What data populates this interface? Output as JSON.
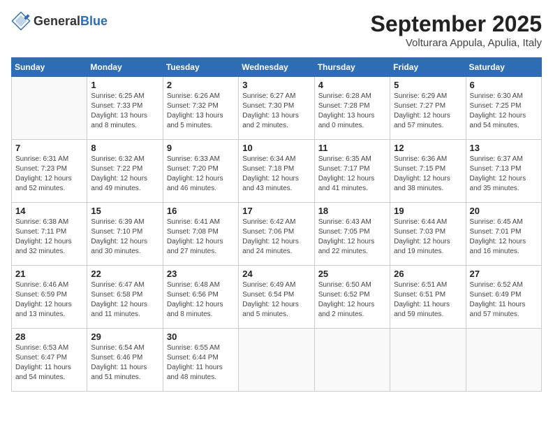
{
  "header": {
    "logo": {
      "general": "General",
      "blue": "Blue"
    },
    "title": "September 2025",
    "location": "Volturara Appula, Apulia, Italy"
  },
  "weekdays": [
    "Sunday",
    "Monday",
    "Tuesday",
    "Wednesday",
    "Thursday",
    "Friday",
    "Saturday"
  ],
  "weeks": [
    [
      {
        "day": "",
        "info": ""
      },
      {
        "day": "1",
        "info": "Sunrise: 6:25 AM\nSunset: 7:33 PM\nDaylight: 13 hours\nand 8 minutes."
      },
      {
        "day": "2",
        "info": "Sunrise: 6:26 AM\nSunset: 7:32 PM\nDaylight: 13 hours\nand 5 minutes."
      },
      {
        "day": "3",
        "info": "Sunrise: 6:27 AM\nSunset: 7:30 PM\nDaylight: 13 hours\nand 2 minutes."
      },
      {
        "day": "4",
        "info": "Sunrise: 6:28 AM\nSunset: 7:28 PM\nDaylight: 13 hours\nand 0 minutes."
      },
      {
        "day": "5",
        "info": "Sunrise: 6:29 AM\nSunset: 7:27 PM\nDaylight: 12 hours\nand 57 minutes."
      },
      {
        "day": "6",
        "info": "Sunrise: 6:30 AM\nSunset: 7:25 PM\nDaylight: 12 hours\nand 54 minutes."
      }
    ],
    [
      {
        "day": "7",
        "info": "Sunrise: 6:31 AM\nSunset: 7:23 PM\nDaylight: 12 hours\nand 52 minutes."
      },
      {
        "day": "8",
        "info": "Sunrise: 6:32 AM\nSunset: 7:22 PM\nDaylight: 12 hours\nand 49 minutes."
      },
      {
        "day": "9",
        "info": "Sunrise: 6:33 AM\nSunset: 7:20 PM\nDaylight: 12 hours\nand 46 minutes."
      },
      {
        "day": "10",
        "info": "Sunrise: 6:34 AM\nSunset: 7:18 PM\nDaylight: 12 hours\nand 43 minutes."
      },
      {
        "day": "11",
        "info": "Sunrise: 6:35 AM\nSunset: 7:17 PM\nDaylight: 12 hours\nand 41 minutes."
      },
      {
        "day": "12",
        "info": "Sunrise: 6:36 AM\nSunset: 7:15 PM\nDaylight: 12 hours\nand 38 minutes."
      },
      {
        "day": "13",
        "info": "Sunrise: 6:37 AM\nSunset: 7:13 PM\nDaylight: 12 hours\nand 35 minutes."
      }
    ],
    [
      {
        "day": "14",
        "info": "Sunrise: 6:38 AM\nSunset: 7:11 PM\nDaylight: 12 hours\nand 32 minutes."
      },
      {
        "day": "15",
        "info": "Sunrise: 6:39 AM\nSunset: 7:10 PM\nDaylight: 12 hours\nand 30 minutes."
      },
      {
        "day": "16",
        "info": "Sunrise: 6:41 AM\nSunset: 7:08 PM\nDaylight: 12 hours\nand 27 minutes."
      },
      {
        "day": "17",
        "info": "Sunrise: 6:42 AM\nSunset: 7:06 PM\nDaylight: 12 hours\nand 24 minutes."
      },
      {
        "day": "18",
        "info": "Sunrise: 6:43 AM\nSunset: 7:05 PM\nDaylight: 12 hours\nand 22 minutes."
      },
      {
        "day": "19",
        "info": "Sunrise: 6:44 AM\nSunset: 7:03 PM\nDaylight: 12 hours\nand 19 minutes."
      },
      {
        "day": "20",
        "info": "Sunrise: 6:45 AM\nSunset: 7:01 PM\nDaylight: 12 hours\nand 16 minutes."
      }
    ],
    [
      {
        "day": "21",
        "info": "Sunrise: 6:46 AM\nSunset: 6:59 PM\nDaylight: 12 hours\nand 13 minutes."
      },
      {
        "day": "22",
        "info": "Sunrise: 6:47 AM\nSunset: 6:58 PM\nDaylight: 12 hours\nand 11 minutes."
      },
      {
        "day": "23",
        "info": "Sunrise: 6:48 AM\nSunset: 6:56 PM\nDaylight: 12 hours\nand 8 minutes."
      },
      {
        "day": "24",
        "info": "Sunrise: 6:49 AM\nSunset: 6:54 PM\nDaylight: 12 hours\nand 5 minutes."
      },
      {
        "day": "25",
        "info": "Sunrise: 6:50 AM\nSunset: 6:52 PM\nDaylight: 12 hours\nand 2 minutes."
      },
      {
        "day": "26",
        "info": "Sunrise: 6:51 AM\nSunset: 6:51 PM\nDaylight: 11 hours\nand 59 minutes."
      },
      {
        "day": "27",
        "info": "Sunrise: 6:52 AM\nSunset: 6:49 PM\nDaylight: 11 hours\nand 57 minutes."
      }
    ],
    [
      {
        "day": "28",
        "info": "Sunrise: 6:53 AM\nSunset: 6:47 PM\nDaylight: 11 hours\nand 54 minutes."
      },
      {
        "day": "29",
        "info": "Sunrise: 6:54 AM\nSunset: 6:46 PM\nDaylight: 11 hours\nand 51 minutes."
      },
      {
        "day": "30",
        "info": "Sunrise: 6:55 AM\nSunset: 6:44 PM\nDaylight: 11 hours\nand 48 minutes."
      },
      {
        "day": "",
        "info": ""
      },
      {
        "day": "",
        "info": ""
      },
      {
        "day": "",
        "info": ""
      },
      {
        "day": "",
        "info": ""
      }
    ]
  ]
}
